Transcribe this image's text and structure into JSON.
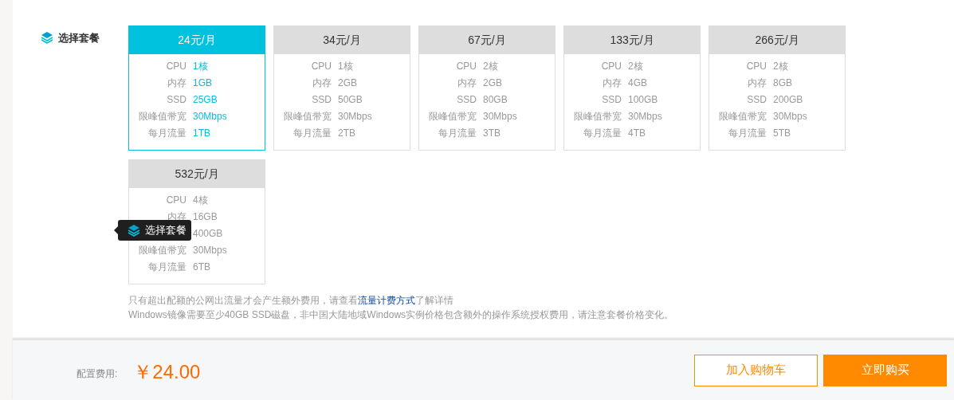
{
  "section": {
    "title": "选择套餐"
  },
  "plans": [
    {
      "price": "24元/月",
      "selected": true,
      "specs": [
        {
          "label": "CPU",
          "value": "1核"
        },
        {
          "label": "内存",
          "value": "1GB"
        },
        {
          "label": "SSD",
          "value": "25GB"
        },
        {
          "label": "限峰值带宽",
          "value": "30Mbps"
        },
        {
          "label": "每月流量",
          "value": "1TB"
        }
      ]
    },
    {
      "price": "34元/月",
      "selected": false,
      "specs": [
        {
          "label": "CPU",
          "value": "1核"
        },
        {
          "label": "内存",
          "value": "2GB"
        },
        {
          "label": "SSD",
          "value": "50GB"
        },
        {
          "label": "限峰值带宽",
          "value": "30Mbps"
        },
        {
          "label": "每月流量",
          "value": "2TB"
        }
      ]
    },
    {
      "price": "67元/月",
      "selected": false,
      "specs": [
        {
          "label": "CPU",
          "value": "2核"
        },
        {
          "label": "内存",
          "value": "2GB"
        },
        {
          "label": "SSD",
          "value": "80GB"
        },
        {
          "label": "限峰值带宽",
          "value": "30Mbps"
        },
        {
          "label": "每月流量",
          "value": "3TB"
        }
      ]
    },
    {
      "price": "133元/月",
      "selected": false,
      "specs": [
        {
          "label": "CPU",
          "value": "2核"
        },
        {
          "label": "内存",
          "value": "4GB"
        },
        {
          "label": "SSD",
          "value": "100GB"
        },
        {
          "label": "限峰值带宽",
          "value": "30Mbps"
        },
        {
          "label": "每月流量",
          "value": "4TB"
        }
      ]
    },
    {
      "price": "266元/月",
      "selected": false,
      "specs": [
        {
          "label": "CPU",
          "value": "2核"
        },
        {
          "label": "内存",
          "value": "8GB"
        },
        {
          "label": "SSD",
          "value": "200GB"
        },
        {
          "label": "限峰值带宽",
          "value": "30Mbps"
        },
        {
          "label": "每月流量",
          "value": "5TB"
        }
      ]
    },
    {
      "price": "532元/月",
      "selected": false,
      "specs": [
        {
          "label": "CPU",
          "value": "4核"
        },
        {
          "label": "内存",
          "value": "16GB"
        },
        {
          "value": "400GB"
        },
        {
          "label": "限峰值带宽",
          "value": "30Mbps"
        },
        {
          "label": "每月流量",
          "value": "6TB"
        }
      ]
    }
  ],
  "tooltip": {
    "text": "选择套餐"
  },
  "notes": [
    {
      "before": "只有超出配额的公网出流量才会产生额外费用，请查看",
      "link": "流量计费方式",
      "after": "了解详情"
    },
    {
      "before": "Windows镜像需要至少40GB SSD磁盘，非中国大陆地域Windows实例价格包含额外的操作系统授权费用，请注意套餐价格变化。"
    }
  ],
  "footer": {
    "label": "配置费用:",
    "price": "￥24.00",
    "buttons": [
      {
        "label": "加入购物车",
        "kind": "secondary"
      },
      {
        "label": "立即购买",
        "kind": "primary"
      }
    ]
  }
}
